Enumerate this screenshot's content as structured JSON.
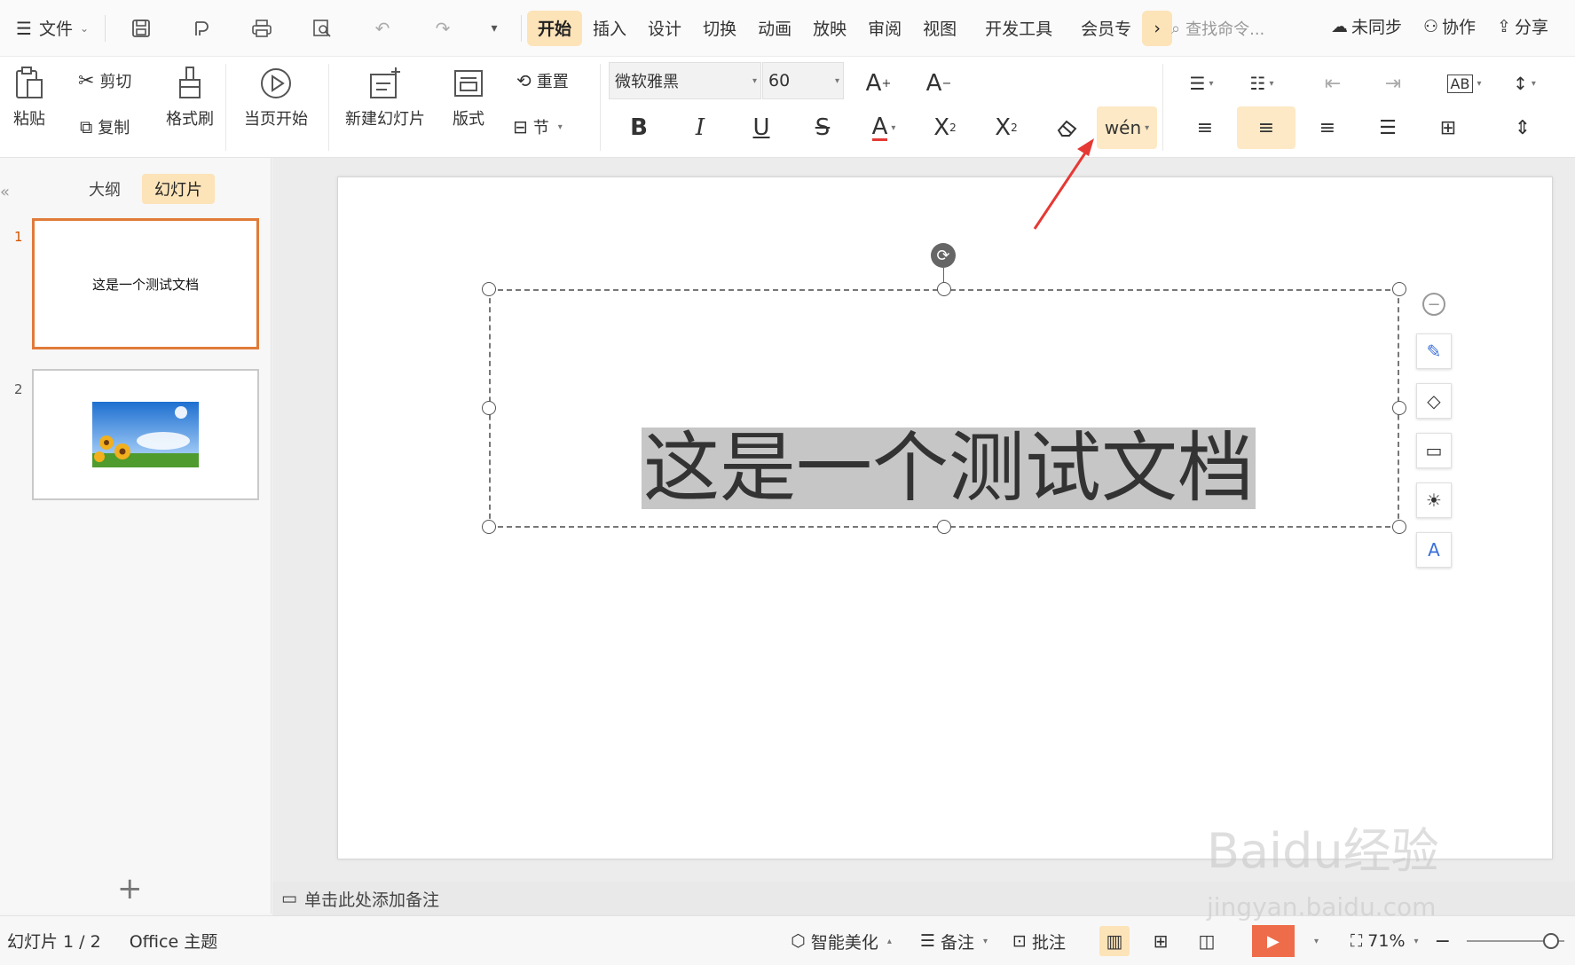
{
  "menubar": {
    "file_label": "文件",
    "tabs": [
      "开始",
      "插入",
      "设计",
      "切换",
      "动画",
      "放映",
      "审阅",
      "视图",
      "开发工具",
      "会员专"
    ],
    "more": "›",
    "search_placeholder": "查找命令...",
    "sync": "未同步",
    "collab": "协作",
    "share": "分享"
  },
  "ribbon": {
    "paste": "粘贴",
    "cut": "剪切",
    "copy": "复制",
    "format_painter": "格式刷",
    "start_from_current": "当页开始",
    "new_slide": "新建幻灯片",
    "layout": "版式",
    "reset": "重置",
    "section": "节",
    "font_name": "微软雅黑",
    "font_size": "60"
  },
  "left_panel": {
    "tab_outline": "大纲",
    "tab_slides": "幻灯片",
    "collapse": "«",
    "slides": [
      {
        "num": "1",
        "text": "这是一个测试文档"
      },
      {
        "num": "2",
        "text": ""
      }
    ],
    "add": "+"
  },
  "slide": {
    "title": "这是一个测试文档"
  },
  "notes": {
    "placeholder": "单击此处添加备注"
  },
  "statusbar": {
    "slide_info": "幻灯片 1 / 2",
    "theme": "Office 主题",
    "beautify": "智能美化",
    "notes": "备注",
    "comments": "批注",
    "zoom": "71%"
  },
  "watermark": {
    "main": "Baidu经验",
    "sub": "jingyan.baidu.com"
  },
  "colors": {
    "accent": "#fce3b8",
    "thumb_active_border": "#e07b39",
    "play": "#ef6c4a",
    "arrow": "#e53935"
  }
}
